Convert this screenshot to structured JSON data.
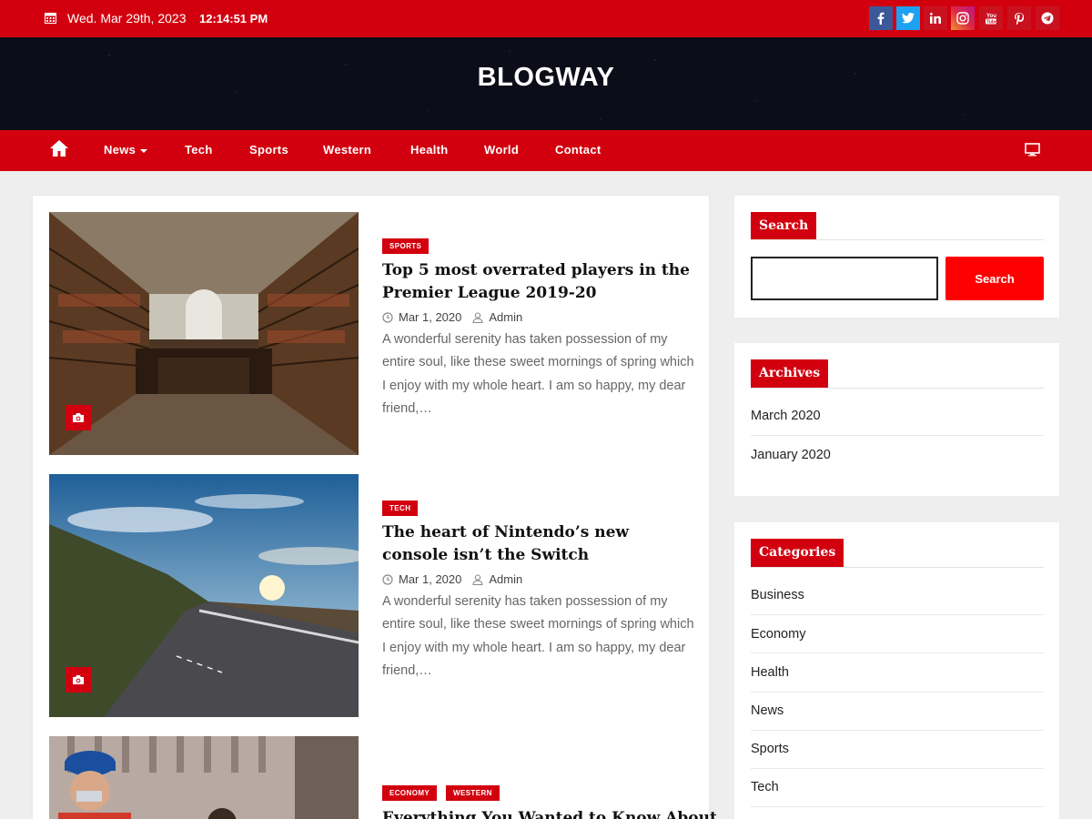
{
  "topbar": {
    "date": "Wed. Mar 29th, 2023",
    "time": "12:14:51 PM",
    "social": [
      {
        "name": "facebook",
        "label": "f",
        "color": "#3b5998"
      },
      {
        "name": "twitter",
        "label": "t",
        "color": "#1da1f2"
      },
      {
        "name": "linkedin",
        "label": "in",
        "color": "#c9121f"
      },
      {
        "name": "instagram",
        "label": "ig",
        "color": "#c13584"
      },
      {
        "name": "youtube",
        "label": "yt",
        "color": "#c9121f"
      },
      {
        "name": "pinterest",
        "label": "p",
        "color": "#c9121f"
      },
      {
        "name": "telegram",
        "label": "tg",
        "color": "#c9121f"
      }
    ]
  },
  "header": {
    "brand": "BLOGWAY"
  },
  "nav": {
    "items": [
      "News",
      "Tech",
      "Sports",
      "Western",
      "Health",
      "World",
      "Contact"
    ]
  },
  "posts": [
    {
      "categories": [
        "SPORTS"
      ],
      "title": "Top 5 most overrated players in the Premier League 2019-20",
      "date": "Mar 1, 2020",
      "author": "Admin",
      "excerpt": "A wonderful serenity has taken possession of my entire soul, like these sweet mornings of spring which I enjoy with my whole heart. I am so happy, my dear friend,…"
    },
    {
      "categories": [
        "TECH"
      ],
      "title": "The heart of Nintendo’s new console isn’t the Switch",
      "date": "Mar 1, 2020",
      "author": "Admin",
      "excerpt": "A wonderful serenity has taken possession of my entire soul, like these sweet mornings of spring which I enjoy with my whole heart. I am so happy, my dear friend,…"
    },
    {
      "categories": [
        "ECONOMY",
        "WESTERN"
      ],
      "title": "Everything You Wanted to Know About"
    }
  ],
  "sidebar": {
    "search": {
      "title": "Search",
      "button": "Search",
      "placeholder": ""
    },
    "archives": {
      "title": "Archives",
      "items": [
        "March 2020",
        "January 2020"
      ]
    },
    "categories": {
      "title": "Categories",
      "items": [
        "Business",
        "Economy",
        "Health",
        "News",
        "Sports",
        "Tech"
      ]
    }
  },
  "colors": {
    "primary": "#d2000f",
    "header_bg": "#0c0d19",
    "search_button": "#ff0000",
    "page_bg": "#eeeeee"
  }
}
